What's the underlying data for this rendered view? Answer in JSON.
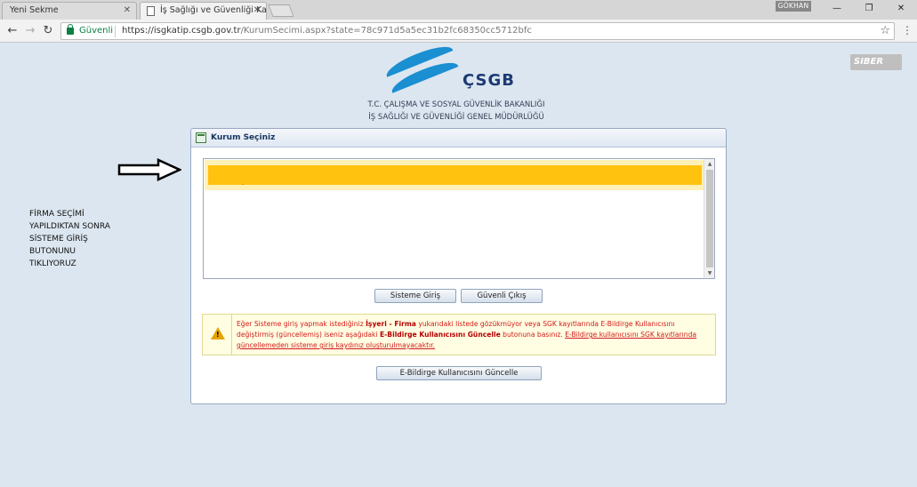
{
  "browser": {
    "tabs": [
      {
        "label": "Yeni Sekme"
      },
      {
        "label": "İş Sağlığı ve Güvenliği Ka"
      }
    ],
    "user_badge": "GÖKHAN",
    "secure_label": "Güvenli",
    "url_host": "https://isgkatip.csgb.gov.tr",
    "url_path": "/KurumSecimi.aspx?state=78c971d5a5ec31b2fc68350cc5712bfc"
  },
  "header": {
    "logo_text": "ÇSGB",
    "ministry_line1": "T.C. ÇALIŞMA VE SOSYAL GÜVENLİK BAKANLIĞI",
    "ministry_line2": "İŞ SAĞLIĞI VE GÜVENLİĞİ GENEL MÜDÜRLÜĞÜ",
    "watermark": "SIBER"
  },
  "side_note": {
    "lines": [
      "FİRMA SEÇİMİ",
      "YAPILDIKTAN SONRA",
      "SİSTEME GİRİŞ",
      "BUTONUNU",
      "TIKLIYORUZ"
    ]
  },
  "panel": {
    "title": "Kurum Seçiniz",
    "selected_item_text": ".",
    "login_button": "Sisteme Giriş",
    "logout_button": "Güvenli Çıkış",
    "update_button": "E-Bildirge Kullanıcısını Güncelle"
  },
  "warning": {
    "part1": "Eğer Sisteme giriş yapmak istediğiniz ",
    "bold1": "İşyeri - Firma",
    "part2": " yukarıdaki listede gözükmüyor veya SGK kayıtlarında E-Bildirge Kullanıcısını değiştirmiş (güncellemiş) iseniz aşağıdaki ",
    "bold2": "E-Bildirge Kullanıcısını Güncelle",
    "part3": " butonuna basınız. ",
    "underlined": "E-Bildirge kullanıcısını SGK kayıtlarında güncellemeden sisteme giriş kaydınız oluşturulmayacaktır."
  },
  "colors": {
    "selected_row": "#ffc20e",
    "warning_text": "#d31a1a",
    "page_bg": "#dce6f0"
  }
}
